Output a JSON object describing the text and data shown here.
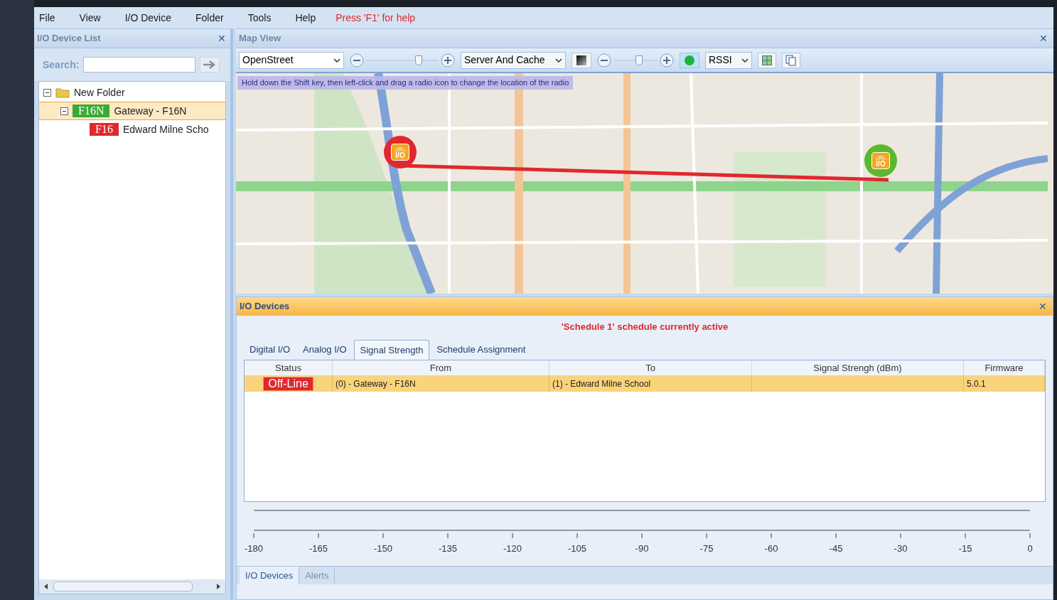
{
  "menu": [
    {
      "label": "File"
    },
    {
      "label": "View"
    },
    {
      "label": "I/O Device"
    },
    {
      "label": "Folder"
    },
    {
      "label": "Tools"
    },
    {
      "label": "Help"
    }
  ],
  "help_hint": "Press 'F1' for help",
  "device_list": {
    "title": "I/O Device List",
    "close": "✕",
    "search_label": "Search:",
    "tree": [
      {
        "label": "New Folder",
        "kind": "folder",
        "expanded": true,
        "selected": false,
        "children": [
          {
            "label": "Gateway - F16N",
            "kind": "device",
            "badge": "F16N",
            "color": "#3aaa35",
            "expanded": true,
            "selected": true,
            "children": [
              {
                "label": "Edward Milne Scho",
                "kind": "device",
                "badge": "F16",
                "color": "#e0282e",
                "selected": false
              }
            ]
          }
        ]
      }
    ]
  },
  "map_view": {
    "title": "Map View",
    "close": "✕",
    "provider": "OpenStreet",
    "cache": "Server And Cache",
    "zoom_slider": {
      "level": 0.75
    },
    "opacity_slider": {
      "level": 0.6
    },
    "metric": "RSSI",
    "hint": "Hold down the Shift key, then left-click and drag a radio icon to change the location of the radio",
    "markers": [
      {
        "label": "I/O",
        "color": "#e0282e"
      },
      {
        "label": "I/O",
        "color": "#5cb82e"
      }
    ]
  },
  "io_devices": {
    "title": "I/O Devices",
    "close": "✕",
    "schedule_notice": "'Schedule 1' schedule currently active",
    "tabs": [
      {
        "label": "Digital I/O",
        "selected": false
      },
      {
        "label": "Analog I/O",
        "selected": false
      },
      {
        "label": "Signal Strength",
        "selected": true
      },
      {
        "label": "Schedule Assignment",
        "selected": false
      }
    ],
    "columns": [
      "Status",
      "From",
      "To",
      "Signal Strengh (dBm)",
      "Firmware"
    ],
    "rows": [
      {
        "status": "Off-Line",
        "from": "(0) - Gateway - F16N",
        "to": "(1) - Edward Milne School",
        "signal": "",
        "firmware": "5.0.1",
        "selected": true
      }
    ],
    "scale_ticks": [
      "-180",
      "-165",
      "-150",
      "-135",
      "-120",
      "-105",
      "-90",
      "-75",
      "-60",
      "-45",
      "-30",
      "-15",
      "0"
    ]
  },
  "bottom_tabs": [
    {
      "label": "I/O Devices",
      "selected": true
    },
    {
      "label": "Alerts",
      "selected": false
    }
  ]
}
